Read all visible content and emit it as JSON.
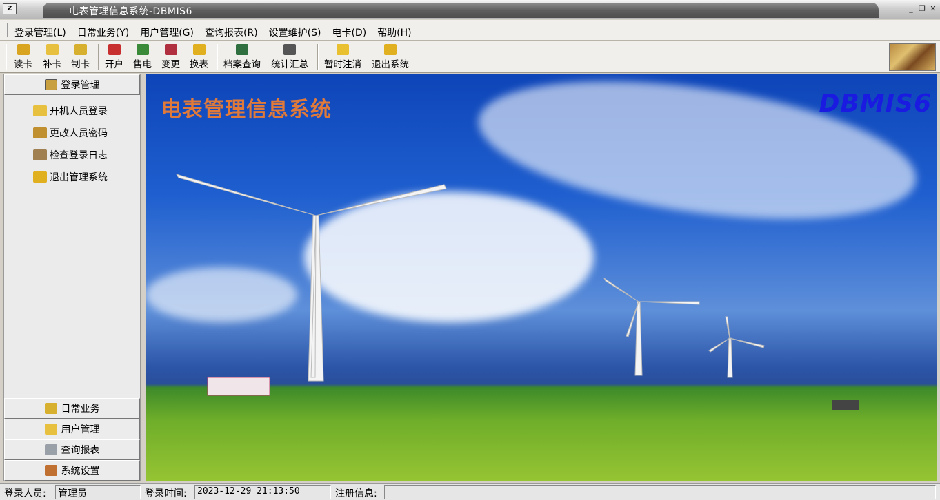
{
  "window": {
    "title": "电表管理信息系统-DBMIS6",
    "icon": "app-icon",
    "controls": [
      "minimize",
      "restore",
      "close"
    ]
  },
  "menu": [
    {
      "label": "登录管理(L)"
    },
    {
      "label": "日常业务(Y)"
    },
    {
      "label": "用户管理(G)"
    },
    {
      "label": "查询报表(R)"
    },
    {
      "label": "设置维护(S)"
    },
    {
      "label": "电卡(D)"
    },
    {
      "label": "帮助(H)"
    }
  ],
  "toolbar": [
    {
      "label": "读卡",
      "icon": "read-card-icon",
      "color": "#d9a520"
    },
    {
      "label": "补卡",
      "icon": "reissue-card-icon",
      "color": "#e8c040"
    },
    {
      "label": "制卡",
      "icon": "make-card-icon",
      "color": "#d8b030"
    },
    {
      "label": "开户",
      "icon": "open-account-icon",
      "color": "#c83030"
    },
    {
      "label": "售电",
      "icon": "sell-power-icon",
      "color": "#3a8a3a"
    },
    {
      "label": "变更",
      "icon": "change-icon",
      "color": "#b03040"
    },
    {
      "label": "换表",
      "icon": "replace-meter-icon",
      "color": "#e0b020"
    },
    {
      "label": "档案查询",
      "icon": "archive-search-icon",
      "color": "#307040"
    },
    {
      "label": "统计汇总",
      "icon": "statistics-icon",
      "color": "#555555"
    },
    {
      "label": "暂时注消",
      "icon": "temporary-logout-icon",
      "color": "#e8c030"
    },
    {
      "label": "退出系统",
      "icon": "exit-system-icon",
      "color": "#e0b020"
    }
  ],
  "sidebar": {
    "top_header": {
      "label": "登录管理",
      "icon": "login-manage-icon"
    },
    "items": [
      {
        "label": "开机人员登录",
        "icon": "folder-open-icon"
      },
      {
        "label": "更改人员密码",
        "icon": "key-icon"
      },
      {
        "label": "检查登录日志",
        "icon": "log-book-icon"
      },
      {
        "label": "退出管理系统",
        "icon": "exit-folder-icon"
      }
    ],
    "bottom_headers": [
      {
        "label": "日常业务",
        "icon": "daily-business-icon"
      },
      {
        "label": "用户管理",
        "icon": "user-manage-icon"
      },
      {
        "label": "查询报表",
        "icon": "report-icon"
      },
      {
        "label": "系统设置",
        "icon": "system-settings-icon"
      }
    ]
  },
  "main": {
    "title": "电表管理信息系统",
    "brand": "DBMIS6",
    "title_color": "#e07a3a",
    "brand_color": "#1a1ae0"
  },
  "status": {
    "user_label": "登录人员:",
    "user_value": "管理员",
    "time_label": "登录时间:",
    "time_value": "2023-12-29 21:13:50",
    "reg_label": "注册信息:",
    "reg_value": ""
  }
}
